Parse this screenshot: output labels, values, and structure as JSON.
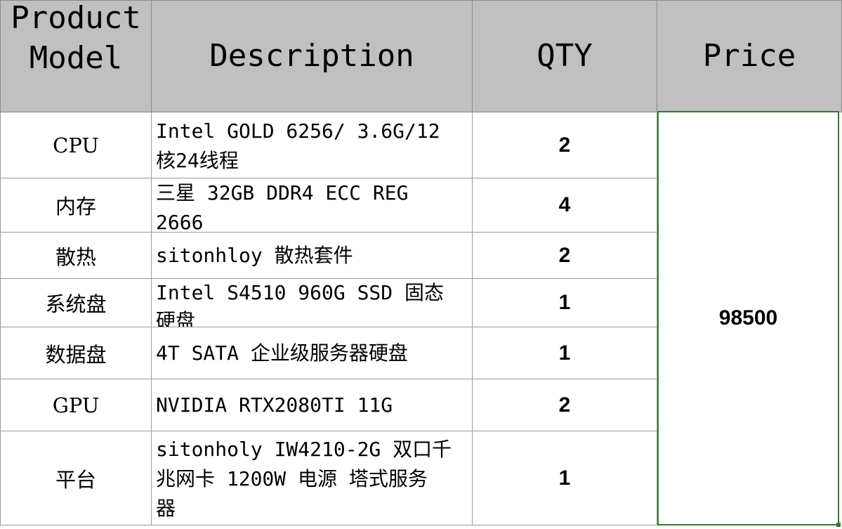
{
  "header": {
    "model": "Product Model",
    "model_line1": "Product",
    "model_line2": "Model",
    "description": "Description",
    "qty": "QTY",
    "price": "Price"
  },
  "rows": [
    {
      "model": "CPU",
      "desc_line1": "Intel  GOLD 6256/ 3.6G/12",
      "desc_line2": "核24线程",
      "desc_line3": "",
      "qty": "2"
    },
    {
      "model": "内存",
      "desc_line1": "三星 32GB DDR4  ECC REG",
      "desc_line2": "2666",
      "desc_line3": "",
      "qty": "4"
    },
    {
      "model": "散热",
      "desc_line1": "sitonhloy 散热套件",
      "desc_line2": "",
      "desc_line3": "",
      "qty": "2"
    },
    {
      "model": "系统盘",
      "desc_line1": "Intel S4510 960G SSD 固态",
      "desc_line2": "硬盘",
      "desc_line3": "",
      "qty": "1"
    },
    {
      "model": "数据盘",
      "desc_line1": "4T SATA 企业级服务器硬盘",
      "desc_line2": "",
      "desc_line3": "",
      "qty": "1"
    },
    {
      "model": "GPU",
      "desc_line1": "NVIDIA RTX2080TI 11G",
      "desc_line2": "",
      "desc_line3": "",
      "qty": "2"
    },
    {
      "model": "平台",
      "desc_line1": "sitonholy IW4210-2G 双口千",
      "desc_line2": "兆网卡 1200W 电源 塔式服务",
      "desc_line3": "器",
      "qty": "1"
    }
  ],
  "price": "98500",
  "colors": {
    "header_bg": "#c0c0c0",
    "selection_border": "#2e7d32",
    "grid": "#9a9a9a"
  }
}
